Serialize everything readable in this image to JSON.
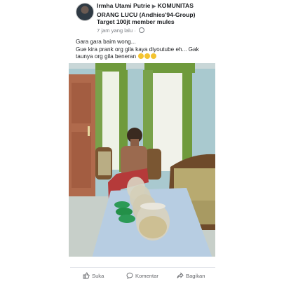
{
  "post": {
    "author": "Irmha Utami Putrie",
    "separator": "▶",
    "group": "KOMUNITAS ORANG LUCU (Andhies'94-Group) Target 100jt member mules",
    "time": "7 jam yang lalu",
    "time_sep": "·",
    "line1": "Gara gara baim wong...",
    "line2": "Gue kira prank org gila kaya diyoutube eh... Gak taunya org gila beneran",
    "reaction_emojis": [
      "sweat-smile",
      "sweat-smile",
      "sweat-smile"
    ]
  },
  "actions": {
    "like": "Suka",
    "comment": "Komentar",
    "share": "Bagikan"
  },
  "colors": {
    "text": "#1c1e21",
    "muted": "#65676b",
    "wall": "#a9c9cf",
    "curtain_green": "#6f9a3c",
    "door": "#b06a4c"
  },
  "icons": [
    "globe-icon",
    "like-icon",
    "comment-icon",
    "share-icon"
  ]
}
